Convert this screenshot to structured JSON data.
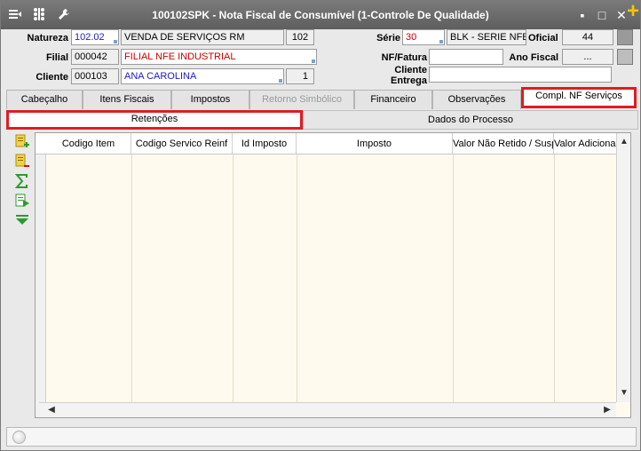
{
  "window": {
    "title": "100102SPK - Nota Fiscal de Consumível (1-Controle De Qualidade)",
    "icons": [
      "list-icon",
      "tree-icon",
      "wrench-icon"
    ],
    "controls": {
      "minimize": "▪",
      "maximize": "□",
      "close": "✕",
      "add": "+"
    }
  },
  "form": {
    "natureza": {
      "label": "Natureza",
      "code": "102.02",
      "desc": "VENDA DE SERVIÇOS RM",
      "num": "102"
    },
    "filial": {
      "label": "Filial",
      "code": "000042",
      "desc": "FILIAL NFE INDUSTRIAL"
    },
    "cliente": {
      "label": "Cliente",
      "code": "000103",
      "desc": "ANA CAROLINA",
      "num": "1"
    },
    "serie": {
      "label": "Série",
      "code": "30",
      "desc": "BLK - SERIE NFE",
      "oficial_label": "Oficial",
      "oficial_value": "44"
    },
    "nf_fatura": {
      "label": "NF/Fatura",
      "value": "",
      "ano_label": "Ano Fiscal",
      "ano_value": "..."
    },
    "cliente_entrega": {
      "label_line1": "Cliente",
      "label_line2": "Entrega",
      "value": ""
    }
  },
  "tabs": [
    {
      "label": "Cabeçalho",
      "state": "normal"
    },
    {
      "label": "Itens Fiscais",
      "state": "normal"
    },
    {
      "label": "Impostos",
      "state": "normal"
    },
    {
      "label": "Retorno Simbólico",
      "state": "disabled"
    },
    {
      "label": "Financeiro",
      "state": "normal"
    },
    {
      "label": "Observações",
      "state": "normal"
    },
    {
      "label": "Compl. NF Serviços",
      "state": "active"
    }
  ],
  "subtabs": [
    {
      "label": "Retenções",
      "state": "active"
    },
    {
      "label": "Dados do Processo",
      "state": "normal"
    }
  ],
  "toolbar": {
    "tools": [
      "add-row-icon",
      "remove-row-icon",
      "sum-icon",
      "export-icon",
      "collapse-icon"
    ]
  },
  "grid": {
    "columns": [
      "Codigo Item",
      "Codigo Servico Reinf",
      "Id Imposto",
      "Imposto",
      "Valor Não Retido / Susp",
      "Valor Adicional"
    ],
    "rows": []
  },
  "colors": {
    "highlight": "#e01b24",
    "grid_background": "#fffaed",
    "titlebar": "#6b6b6b"
  }
}
